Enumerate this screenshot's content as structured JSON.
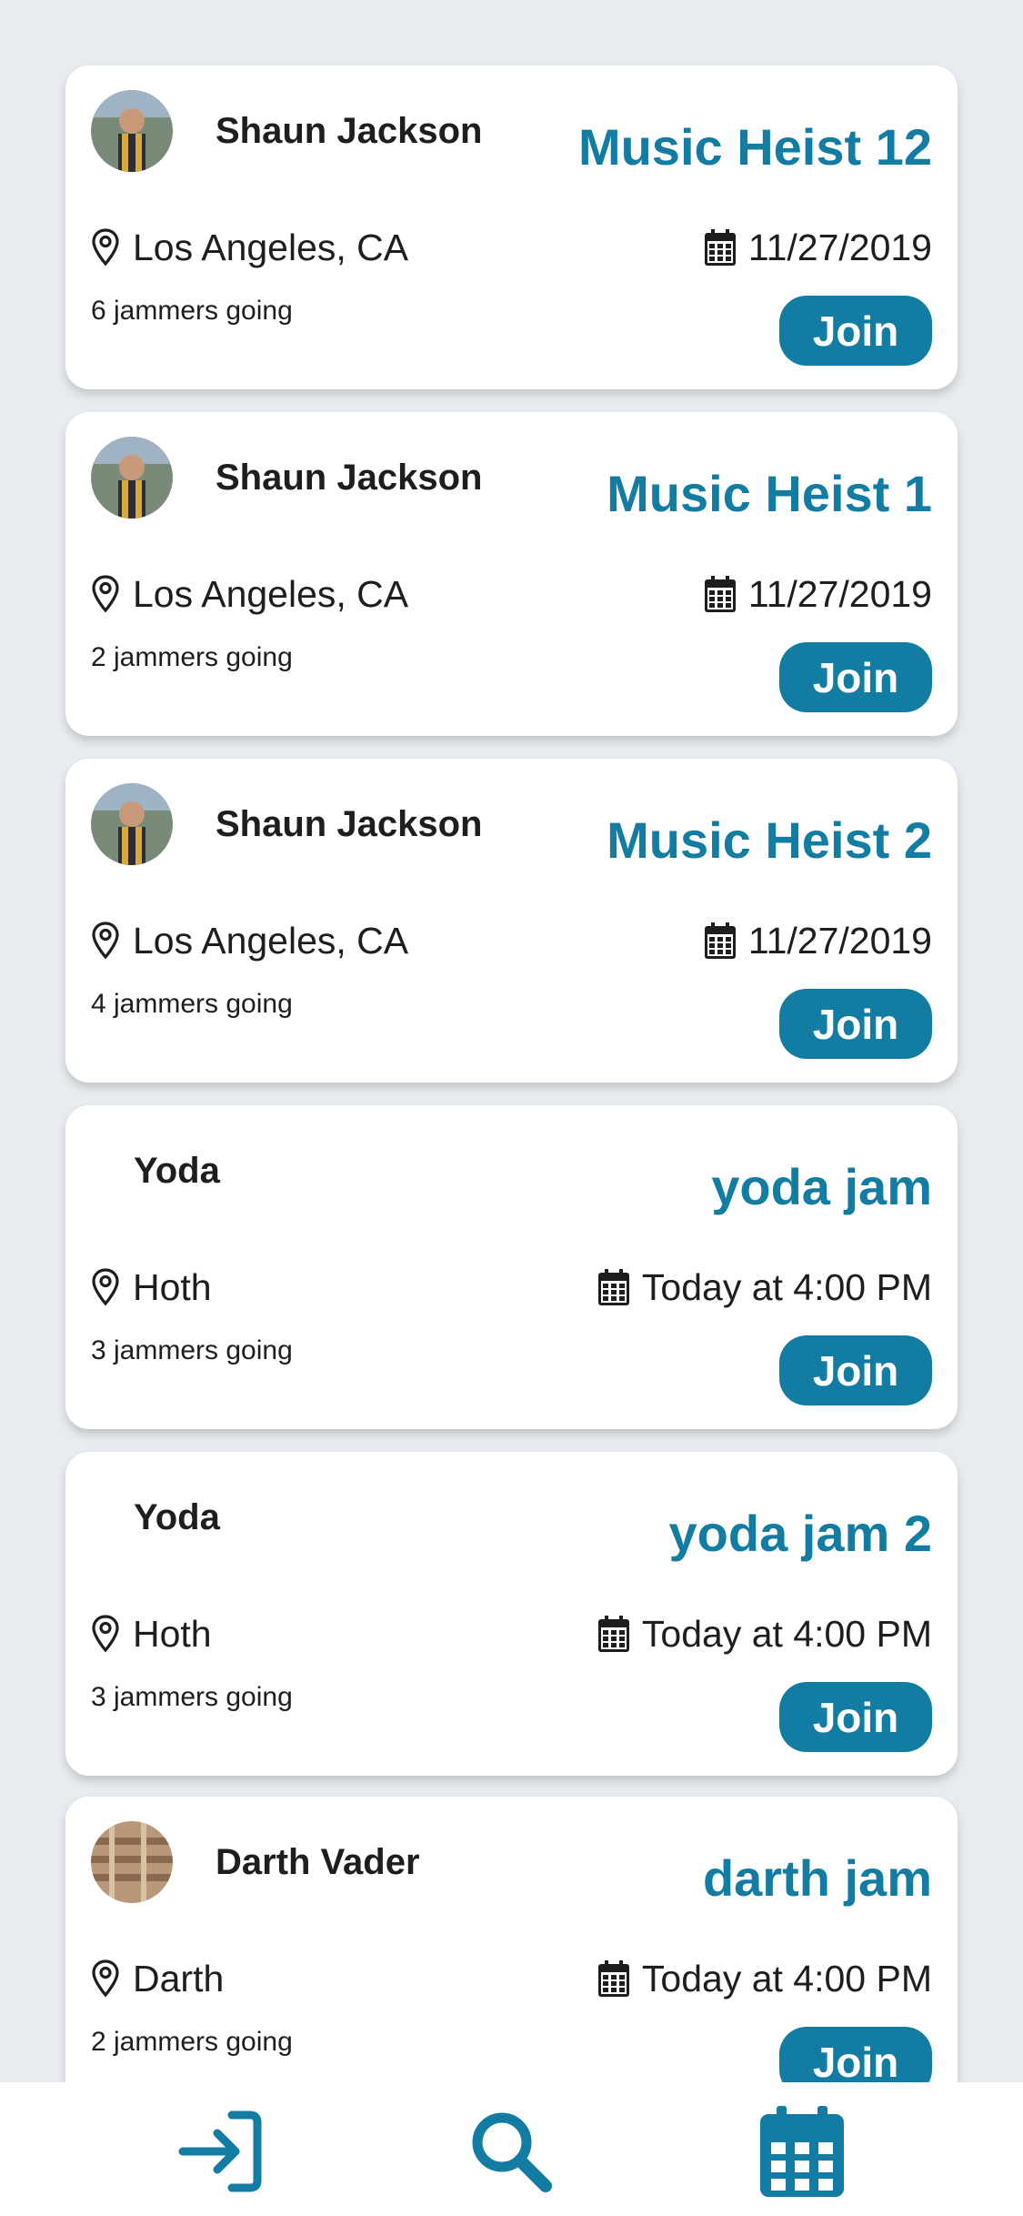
{
  "colors": {
    "accent": "#137ca3",
    "background": "#e8ecf0",
    "card": "#ffffff",
    "text": "#1e1e1e"
  },
  "events": [
    {
      "host": "Shaun Jackson",
      "title": "Music Heist 12",
      "location": "Los Angeles, CA",
      "date": "11/27/2019",
      "going": "6 jammers going",
      "join_label": "Join",
      "has_avatar": true
    },
    {
      "host": "Shaun Jackson",
      "title": "Music Heist 1",
      "location": "Los Angeles, CA",
      "date": "11/27/2019",
      "going": "2 jammers going",
      "join_label": "Join",
      "has_avatar": true
    },
    {
      "host": "Shaun Jackson",
      "title": "Music Heist 2",
      "location": "Los Angeles, CA",
      "date": "11/27/2019",
      "going": "4 jammers going",
      "join_label": "Join",
      "has_avatar": true
    },
    {
      "host": "Yoda",
      "title": "yoda jam",
      "location": "Hoth",
      "date": "Today at 4:00 PM",
      "going": "3 jammers going",
      "join_label": "Join",
      "has_avatar": false
    },
    {
      "host": "Yoda",
      "title": "yoda jam 2",
      "location": "Hoth",
      "date": "Today at 4:00 PM",
      "going": "3 jammers going",
      "join_label": "Join",
      "has_avatar": false
    },
    {
      "host": "Darth Vader",
      "title": "darth jam",
      "location": "Darth",
      "date": "Today at 4:00 PM",
      "going": "2 jammers going",
      "join_label": "Join",
      "has_avatar": true
    }
  ],
  "icons": {
    "location": "map-pin-icon",
    "date": "calendar-icon"
  },
  "bottom_nav": [
    {
      "icon": "sign-in-icon"
    },
    {
      "icon": "search-icon"
    },
    {
      "icon": "calendar-icon"
    }
  ]
}
